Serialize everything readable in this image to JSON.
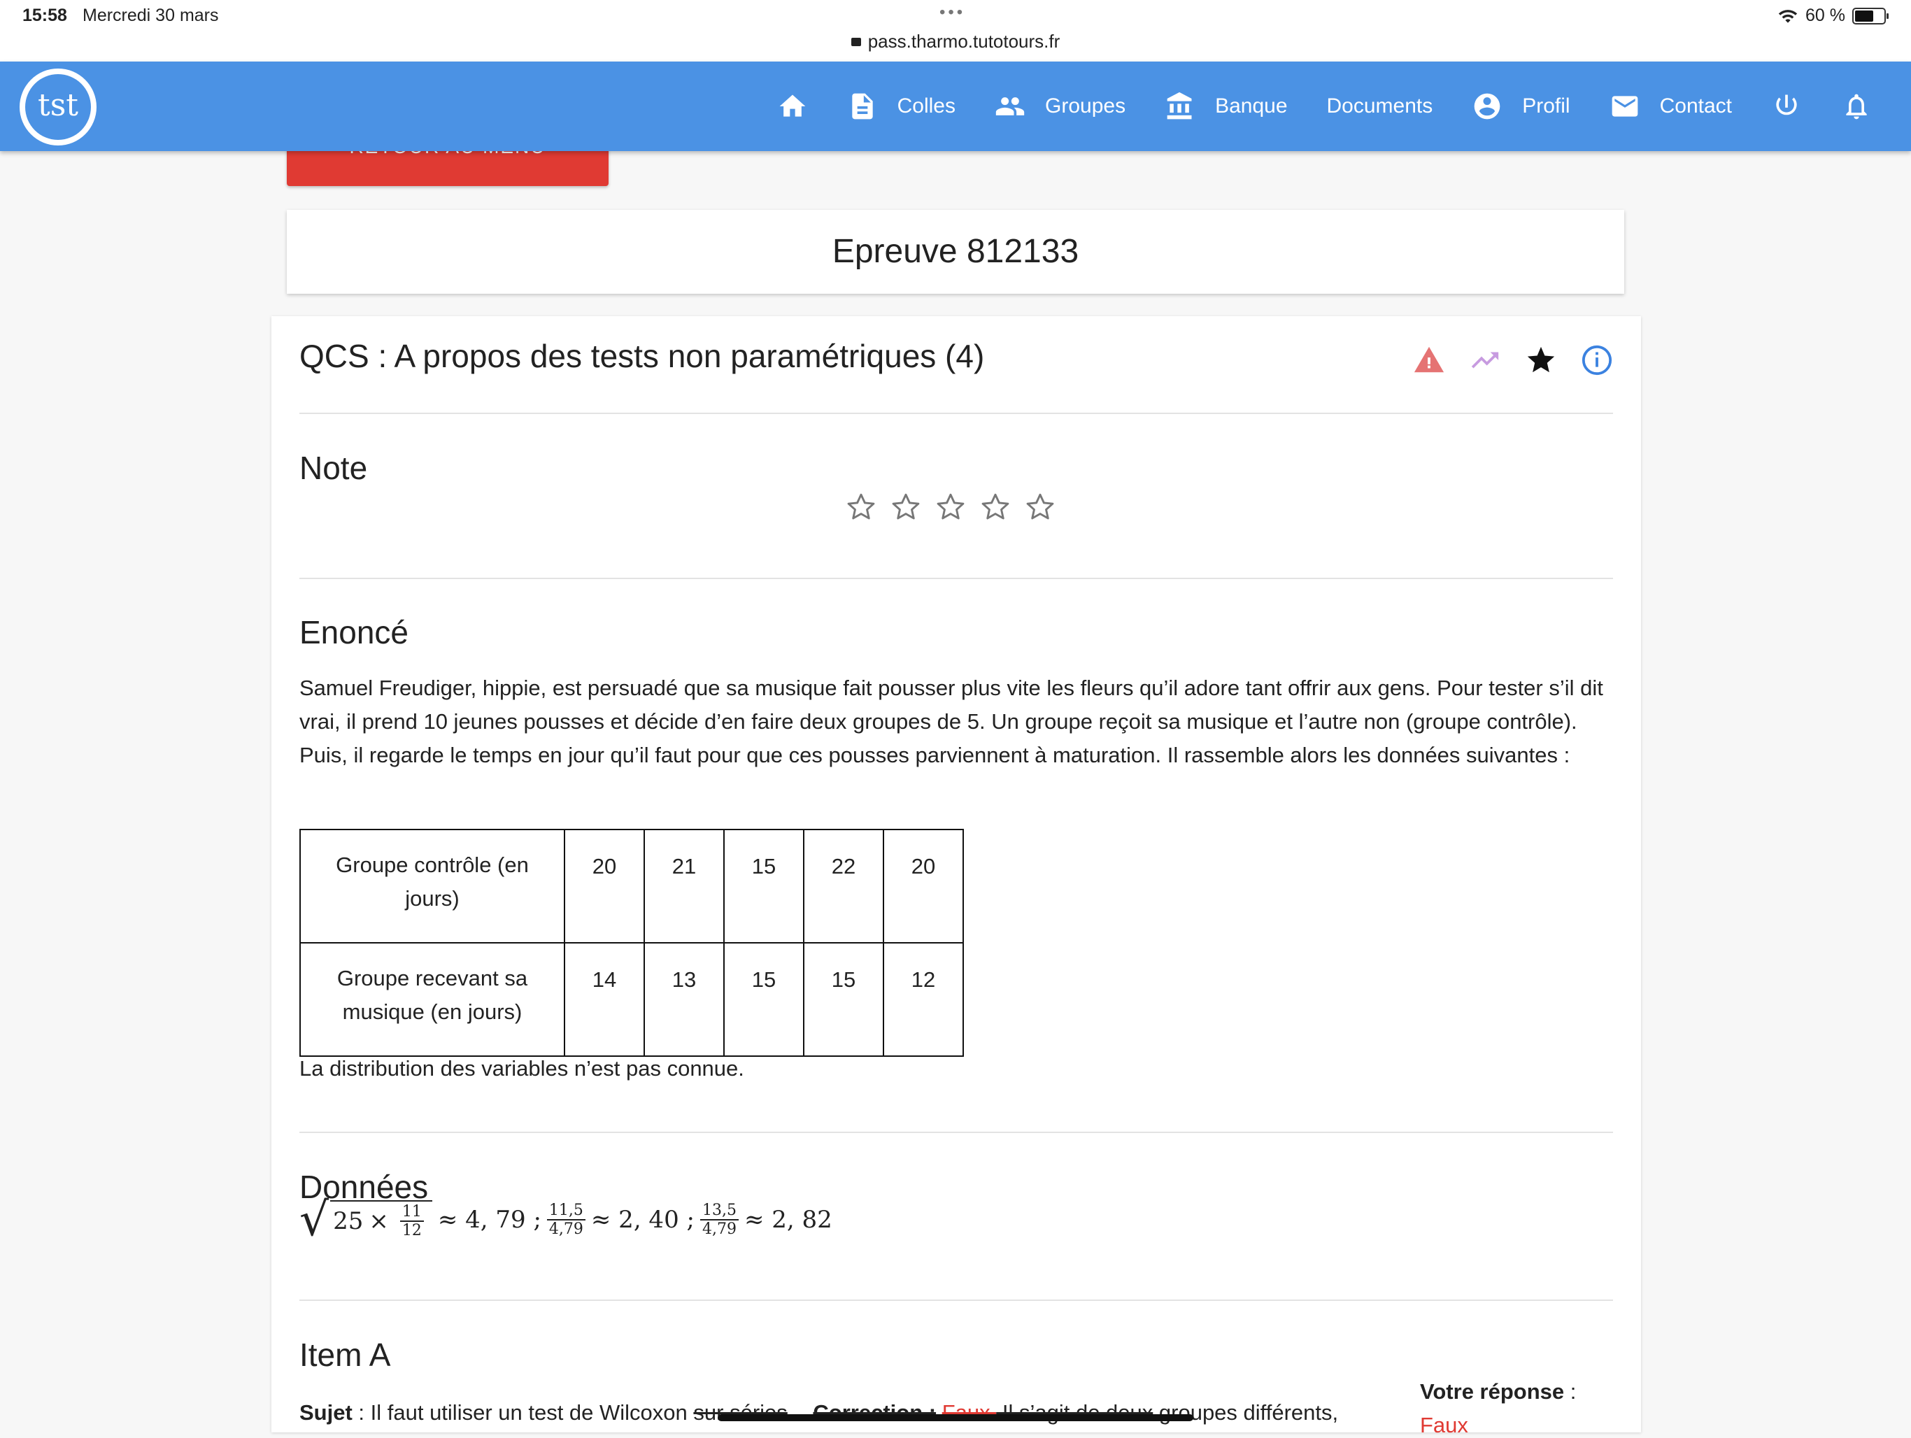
{
  "status_bar": {
    "time": "15:58",
    "date": "Mercredi 30 mars",
    "dots": "•••",
    "url": "pass.tharmo.tutotours.fr",
    "battery": "60 %"
  },
  "app": {
    "logo_text": "tst",
    "nav": [
      {
        "label": "",
        "icon": "home-icon"
      },
      {
        "label": "Colles",
        "icon": "document-icon"
      },
      {
        "label": "Groupes",
        "icon": "people-icon"
      },
      {
        "label": "Banque",
        "icon": "bank-icon"
      },
      {
        "label": "Documents",
        "icon": ""
      },
      {
        "label": "Profil",
        "icon": "account-circle-icon"
      },
      {
        "label": "Contact",
        "icon": "mail-icon"
      },
      {
        "label": "",
        "icon": "power-icon"
      },
      {
        "label": "",
        "icon": "bell-icon"
      }
    ],
    "back_button": "RETOUR AU MENU",
    "colors": {
      "appbar": "#4b92e4",
      "back_button": "#e03a33",
      "warning": "#e57373",
      "trend": "#c79be0",
      "info": "#3b82e0"
    }
  },
  "epreuve_title": "Epreuve 812133",
  "question": {
    "title": "QCS : A propos des tests non paramétriques (4)",
    "note_title": "Note",
    "rating": 0,
    "enonce_title": "Enoncé",
    "enonce_text": "Samuel Freudiger, hippie, est persuadé que sa musique fait pousser plus vite les fleurs qu’il adore tant offrir aux gens. Pour tester s’il dit vrai, il prend 10 jeunes pousses et décide d’en faire deux groupes de 5. Un groupe reçoit sa musique et l’autre non (groupe contrôle). Puis, il regarde le temps en jour qu’il faut pour que ces pousses parviennent à maturation. Il rassemble alors les données suivantes :",
    "table": {
      "rows": [
        {
          "label": "Groupe contrôle (en jours)",
          "values": [
            "20",
            "21",
            "15",
            "22",
            "20"
          ]
        },
        {
          "label": "Groupe recevant sa musique (en jours)",
          "values": [
            "14",
            "13",
            "15",
            "15",
            "12"
          ]
        }
      ]
    },
    "distribution_note": "La distribution des variables n’est pas connue.",
    "donnees_title": "Données",
    "donnees_math": {
      "sqrt_a": "25",
      "times": "×",
      "frac1_num": "11",
      "frac1_den": "12",
      "approx1": "≈ 4, 79 ;",
      "frac2_num": "11,5",
      "frac2_den": "4,79",
      "approx2": "≈ 2, 40 ;",
      "frac3_num": "13,5",
      "frac3_den": "4,79",
      "approx3": "≈ 2, 82"
    },
    "item_a": {
      "title": "Item A",
      "sujet_label": "Sujet",
      "sujet_text": " : Il faut utiliser un test de Wilcoxon ",
      "sujet_struck": "sur séries",
      "correction_label": "Correction :",
      "correction_value": "Faux.",
      "correction_struck": " Il s’agit de deux",
      "correction_rest": " groupes différents,",
      "votre_reponse_label": "Votre réponse",
      "votre_reponse_sep": " :",
      "votre_reponse_value": "Faux"
    }
  }
}
